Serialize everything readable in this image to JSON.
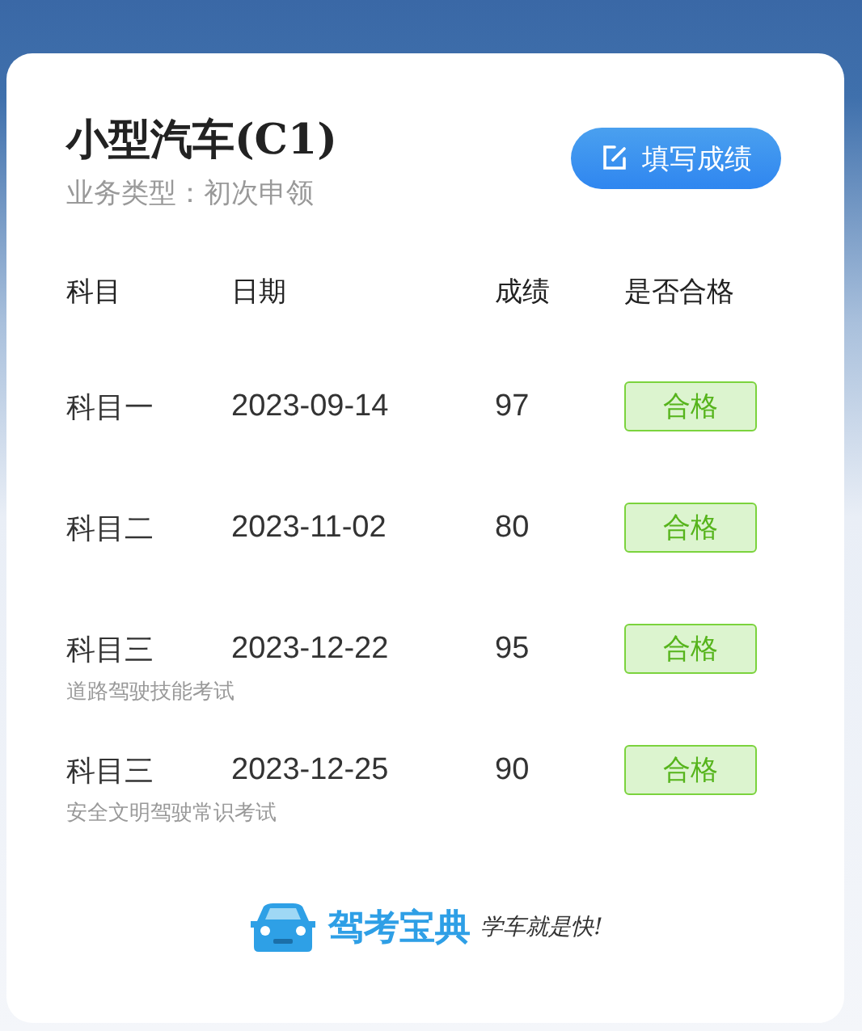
{
  "license": {
    "title": "小型汽车(C1)",
    "subtitle": "业务类型：初次申领",
    "button": "填写成绩"
  },
  "table": {
    "columns": [
      "科目",
      "日期",
      "成绩",
      "是否合格"
    ],
    "rows": [
      {
        "subject": "科目一",
        "date": "2023-09-14",
        "score": "97",
        "result": "合格",
        "passed": true
      },
      {
        "subject": "科目二",
        "date": "2023-11-02",
        "score": "80",
        "result": "合格",
        "passed": true
      },
      {
        "subject": "科目三",
        "note": "道路驾驶技能考试",
        "date": "2023-12-22",
        "score": "95",
        "result": "合格",
        "passed": true
      },
      {
        "subject": "科目三",
        "note": "安全文明驾驶常识考试",
        "date": "2023-12-25",
        "score": "90",
        "result": "合格",
        "passed": true
      }
    ]
  },
  "footer": {
    "brand": "驾考宝典",
    "slogan": "学车就是快!"
  }
}
